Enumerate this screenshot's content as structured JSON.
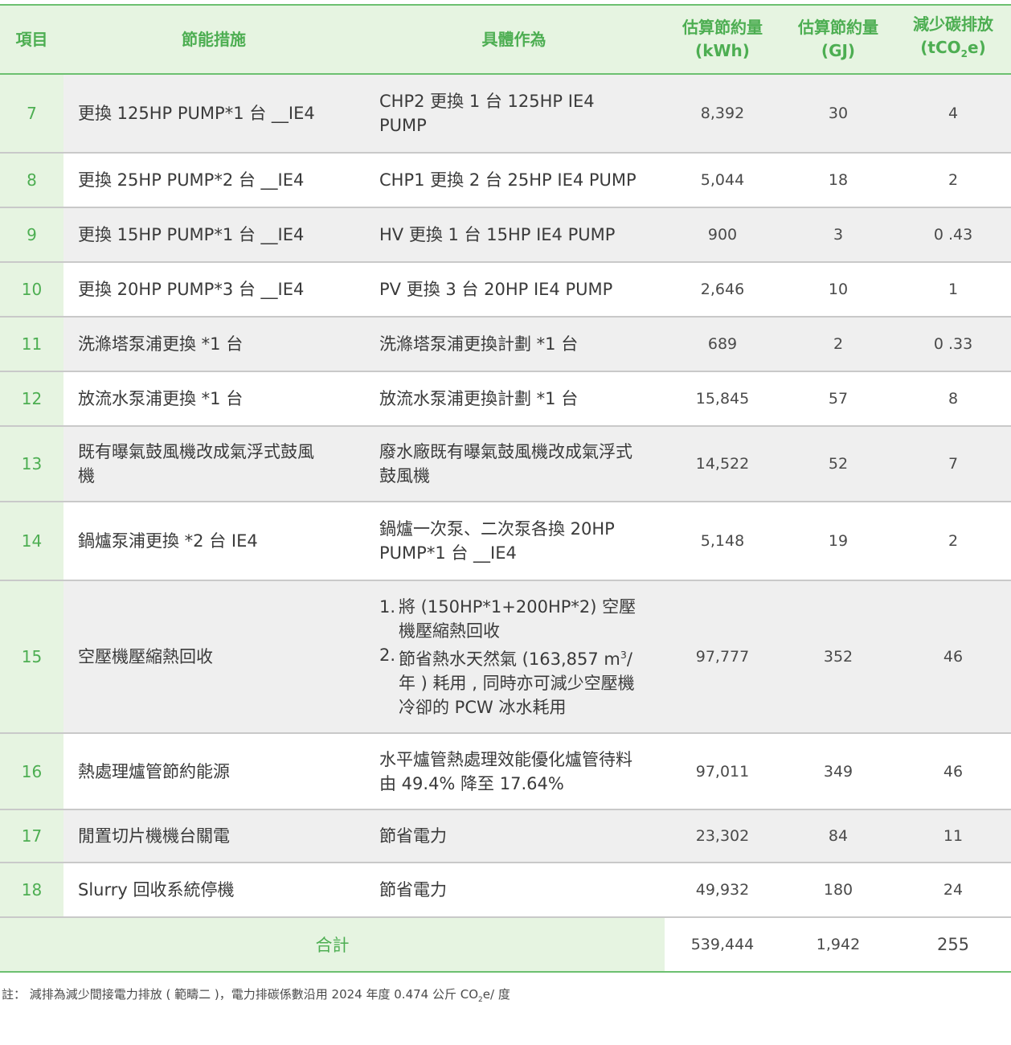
{
  "header": {
    "item": "項目",
    "measure": "節能措施",
    "action": "具體作為",
    "kwh_line1": "估算節約量",
    "kwh_line2": "(kWh)",
    "gj_line1": "估算節約量",
    "gj_line2": "(GJ)",
    "co2_line1": "減少碳排放",
    "co2_pre": "(tCO",
    "co2_sub": "2",
    "co2_post": "e)"
  },
  "rows": [
    {
      "no": "7",
      "measure": "更換 125HP PUMP*1 台 __IE4",
      "action": "CHP2 更換 1 台 125HP IE4 PUMP",
      "kwh": "8,392",
      "gj": "30",
      "co2": "4"
    },
    {
      "no": "8",
      "measure": "更換 25HP PUMP*2 台 __IE4",
      "action": "CHP1 更換 2 台 25HP IE4 PUMP",
      "kwh": "5,044",
      "gj": "18",
      "co2": "2"
    },
    {
      "no": "9",
      "measure": "更換 15HP PUMP*1 台 __IE4",
      "action": "HV 更換 1 台 15HP IE4 PUMP",
      "kwh": "900",
      "gj": "3",
      "co2": "0 .43"
    },
    {
      "no": "10",
      "measure": "更換 20HP PUMP*3 台 __IE4",
      "action": "PV 更換 3 台 20HP IE4 PUMP",
      "kwh": "2,646",
      "gj": "10",
      "co2": "1"
    },
    {
      "no": "11",
      "measure": "洗滌塔泵浦更換 *1 台",
      "action": "洗滌塔泵浦更換計劃 *1 台",
      "kwh": "689",
      "gj": "2",
      "co2": "0 .33"
    },
    {
      "no": "12",
      "measure": "放流水泵浦更換 *1 台",
      "action": "放流水泵浦更換計劃 *1 台",
      "kwh": "15,845",
      "gj": "57",
      "co2": "8"
    },
    {
      "no": "13",
      "measure": "既有曝氣鼓風機改成氣浮式鼓風機",
      "action": "廢水廠既有曝氣鼓風機改成氣浮式鼓風機",
      "kwh": "14,522",
      "gj": "52",
      "co2": "7"
    },
    {
      "no": "14",
      "measure": "鍋爐泵浦更換 *2 台 IE4",
      "action": "鍋爐一次泵、二次泵各換 20HP PUMP*1 台 __IE4",
      "kwh": "5,148",
      "gj": "19",
      "co2": "2"
    },
    {
      "no": "15",
      "measure": "空壓機壓縮熱回收",
      "action_items": [
        {
          "n": "1.",
          "text": "將 (150HP*1+200HP*2) 空壓機壓縮熱回收"
        },
        {
          "n": "2.",
          "text_pre": "節省熱水天然氣 (163,857 m",
          "sup": "3",
          "text_post": "/年 ) 耗用 , 同時亦可減少空壓機冷卻的 PCW 冰水耗用"
        }
      ],
      "kwh": "97,777",
      "gj": "352",
      "co2": "46"
    },
    {
      "no": "16",
      "measure": "熱處理爐管節約能源",
      "action": "水平爐管熱處理效能優化爐管待料由 49.4% 降至 17.64%",
      "kwh": "97,011",
      "gj": "349",
      "co2": "46"
    },
    {
      "no": "17",
      "measure": "閒置切片機機台關電",
      "action": "節省電力",
      "kwh": "23,302",
      "gj": "84",
      "co2": "11"
    },
    {
      "no": "18",
      "measure": "Slurry 回收系統停機",
      "action": "節省電力",
      "kwh": "49,932",
      "gj": "180",
      "co2": "24"
    }
  ],
  "total": {
    "label": "合計",
    "kwh": "539,444",
    "gj": "1,942",
    "co2": "255"
  },
  "note": {
    "pre": "註： 減排為減少間接電力排放 ( 範疇二 )，電力排碳係數沿用 2024 年度 0.474 公斤 CO",
    "sub": "2",
    "post": "e/ 度"
  },
  "colors": {
    "green": "#4dae52",
    "header_bg": "#e6f4e1",
    "row_gray": "#efefef"
  }
}
